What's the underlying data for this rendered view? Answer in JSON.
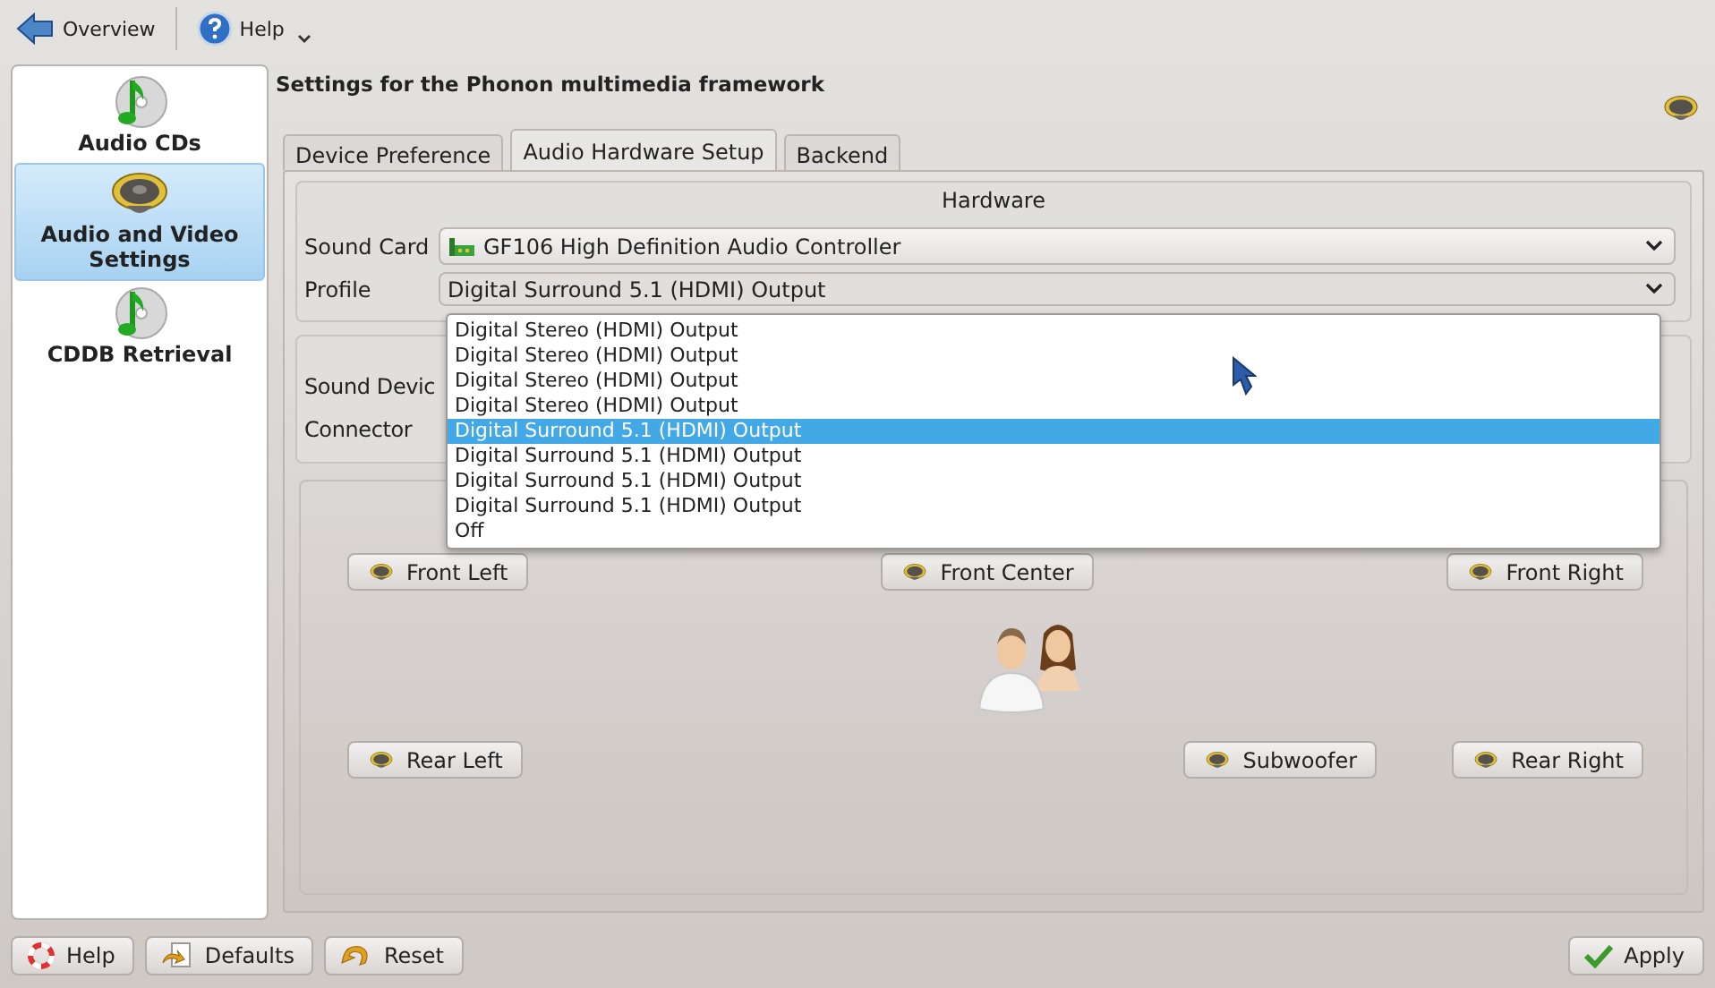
{
  "toolbar": {
    "back": "Overview",
    "help": "Help"
  },
  "sidebar": {
    "items": [
      {
        "label": "Audio CDs",
        "selected": false
      },
      {
        "label": "Audio and Video Settings",
        "selected": true
      },
      {
        "label": "CDDB Retrieval",
        "selected": false
      }
    ]
  },
  "page_title": "Settings for the Phonon multimedia framework",
  "tabs": [
    {
      "label": "Device Preference",
      "selected": false
    },
    {
      "label": "Audio Hardware Setup",
      "selected": true
    },
    {
      "label": "Backend",
      "selected": false
    }
  ],
  "hardware": {
    "title": "Hardware",
    "sound_card_label": "Sound Card",
    "sound_card": "GF106 High Definition Audio Controller",
    "profile_label": "Profile",
    "profile": "Digital Surround 5.1 (HDMI) Output"
  },
  "profile_dropdown": {
    "options": [
      {
        "label": "Digital Stereo (HDMI) Output",
        "selected": false
      },
      {
        "label": "Digital Stereo (HDMI) Output",
        "selected": false
      },
      {
        "label": "Digital Stereo (HDMI) Output",
        "selected": false
      },
      {
        "label": "Digital Stereo (HDMI) Output",
        "selected": false
      },
      {
        "label": "Digital Surround 5.1 (HDMI) Output",
        "selected": true
      },
      {
        "label": "Digital Surround 5.1 (HDMI) Output",
        "selected": false
      },
      {
        "label": "Digital Surround 5.1 (HDMI) Output",
        "selected": false
      },
      {
        "label": "Digital Surround 5.1 (HDMI) Output",
        "selected": false
      },
      {
        "label": "Off",
        "selected": false
      }
    ]
  },
  "device": {
    "sound_device_label": "Sound Devic",
    "connector_label": "Connector"
  },
  "speakers": {
    "front": [
      "Front Left",
      "Front Center",
      "Front Right"
    ],
    "rear": [
      "Rear Left",
      "Subwoofer",
      "Rear Right"
    ]
  },
  "buttons": {
    "left": [
      "Help",
      "Defaults",
      "Reset"
    ],
    "right": [
      "Apply"
    ]
  }
}
